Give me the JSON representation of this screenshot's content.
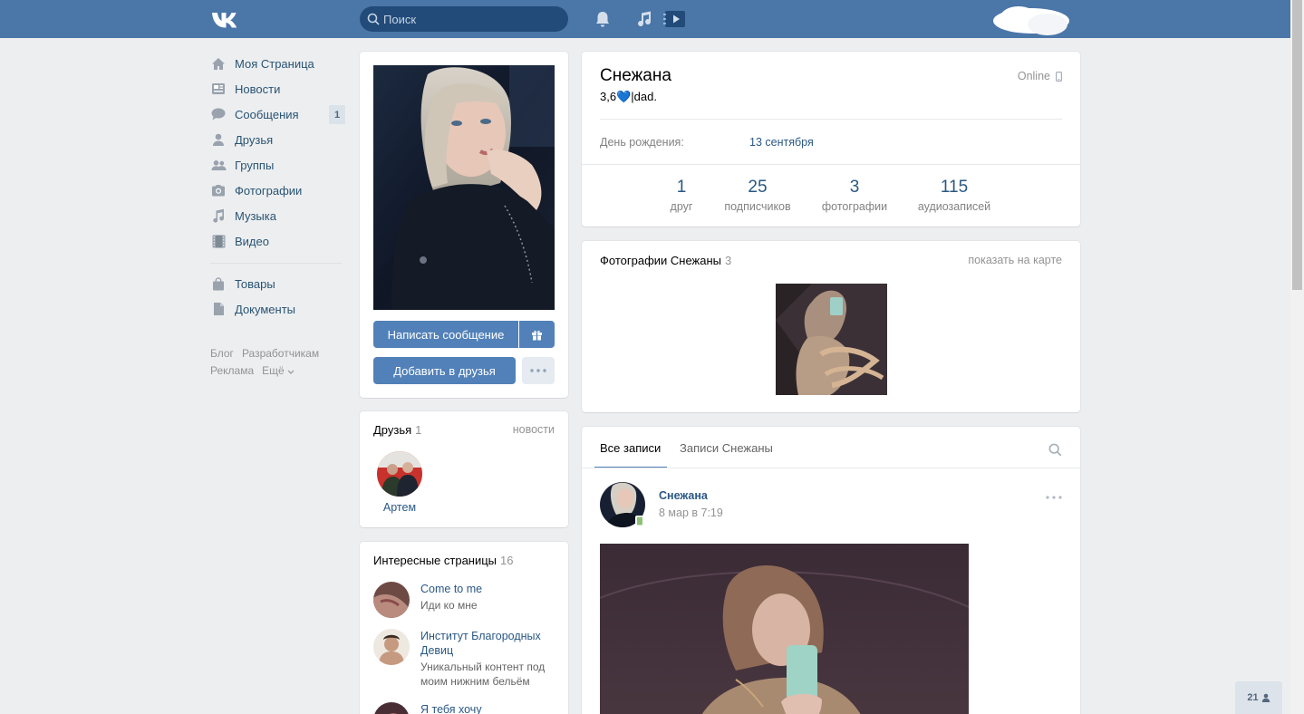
{
  "header": {
    "search_placeholder": "Поиск"
  },
  "nav": {
    "items": [
      {
        "label": "Моя Страница",
        "icon": "home-icon"
      },
      {
        "label": "Новости",
        "icon": "news-icon"
      },
      {
        "label": "Сообщения",
        "icon": "messages-icon",
        "badge": "1"
      },
      {
        "label": "Друзья",
        "icon": "friends-icon"
      },
      {
        "label": "Группы",
        "icon": "groups-icon"
      },
      {
        "label": "Фотографии",
        "icon": "camera-icon"
      },
      {
        "label": "Музыка",
        "icon": "music-icon"
      },
      {
        "label": "Видео",
        "icon": "video-icon"
      },
      {
        "label": "Товары",
        "icon": "bag-icon"
      },
      {
        "label": "Документы",
        "icon": "document-icon"
      }
    ],
    "footer": {
      "blog": "Блог",
      "developers": "Разработчикам",
      "ads": "Реклама",
      "more": "Ещё"
    }
  },
  "profile": {
    "send_message": "Написать сообщение",
    "add_friend": "Добавить в друзья",
    "name": "Снежана",
    "status": "3,6💙|dad.",
    "online": "Online",
    "birthday_label": "День рождения:",
    "birthday_value": "13 сентября",
    "stats": [
      {
        "num": "1",
        "label": "друг"
      },
      {
        "num": "25",
        "label": "подписчиков"
      },
      {
        "num": "3",
        "label": "фотографии"
      },
      {
        "num": "115",
        "label": "аудиозаписей"
      }
    ]
  },
  "friends": {
    "title": "Друзья",
    "count": "1",
    "link": "новости",
    "list": [
      {
        "name": "Артем"
      }
    ]
  },
  "interesting": {
    "title": "Интересные страницы",
    "count": "16",
    "items": [
      {
        "title": "Come to me",
        "sub": "Иди ко мне"
      },
      {
        "title": "Институт Благородных Девиц",
        "sub": "Уникальный контент под моим нижним бельём"
      },
      {
        "title": "Я тебя хочу",
        "sub": ""
      }
    ]
  },
  "photos": {
    "title": "Фотографии Снежаны",
    "count": "3",
    "map_link": "показать на карте"
  },
  "wall": {
    "tab_all": "Все записи",
    "tab_own": "Записи Снежаны",
    "post": {
      "author": "Снежана",
      "date": "8 мар в 7:19"
    }
  },
  "bottom_counter": "21",
  "colors": {
    "header": "#4a76a8",
    "button": "#5181b8",
    "link": "#2a5885",
    "background": "#edeef0"
  }
}
